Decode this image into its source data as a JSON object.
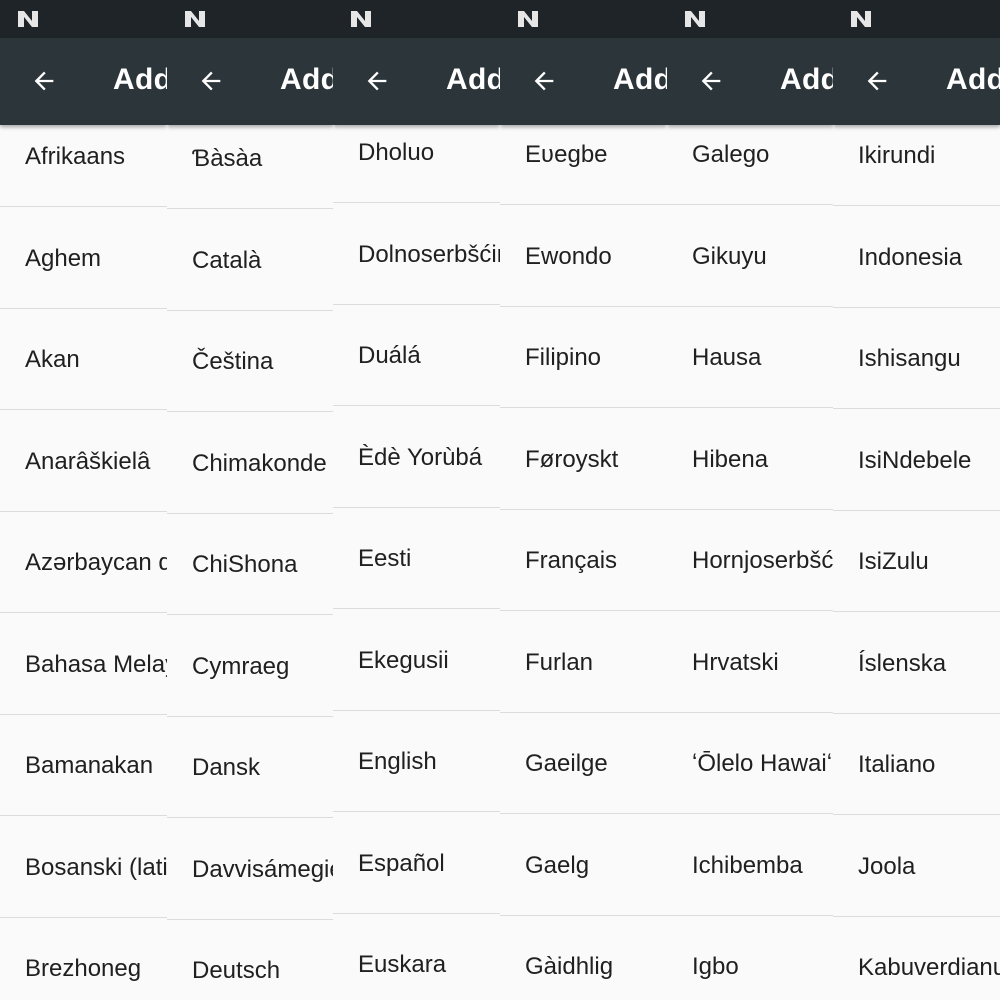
{
  "status_bar": {
    "notification_icon": "android-n-icon"
  },
  "app_bar": {
    "back_icon": "arrow-left-icon",
    "title": "Add"
  },
  "columns": [
    {
      "items": [
        "Afrikaans",
        "Aghem",
        "Akan",
        "Anarâškielâ",
        "Azərbaycan dili",
        "Bahasa Melayu",
        "Bamanakan",
        "Bosanski (latinica)",
        "Brezhoneg"
      ]
    },
    {
      "items": [
        "Ɓàsàa",
        "Català",
        "Čeština",
        "Chimakonde",
        "ChiShona",
        "Cymraeg",
        "Dansk",
        "Davvisámegiella",
        "Deutsch"
      ]
    },
    {
      "items": [
        "Dholuo",
        "Dolnoserbšćina",
        "Duálá",
        "Èdè Yorùbá",
        "Eesti",
        "Ekegusii",
        "English",
        "Español",
        "Euskara"
      ]
    },
    {
      "items": [
        "Eʋegbe",
        "Ewondo",
        "Filipino",
        "Føroyskt",
        "Français",
        "Furlan",
        "Gaeilge",
        "Gaelg",
        "Gàidhlig"
      ]
    },
    {
      "items": [
        "Galego",
        "Gikuyu",
        "Hausa",
        "Hibena",
        "Hornjoserbšćina",
        "Hrvatski",
        "ʻŌlelo Hawaiʻi",
        "Ichibemba",
        "Igbo"
      ]
    },
    {
      "items": [
        "Ikirundi",
        "Indonesia",
        "Ishisangu",
        "IsiNdebele",
        "IsiZulu",
        "Íslenska",
        "Italiano",
        "Joola",
        "Kabuverdianu"
      ]
    }
  ]
}
